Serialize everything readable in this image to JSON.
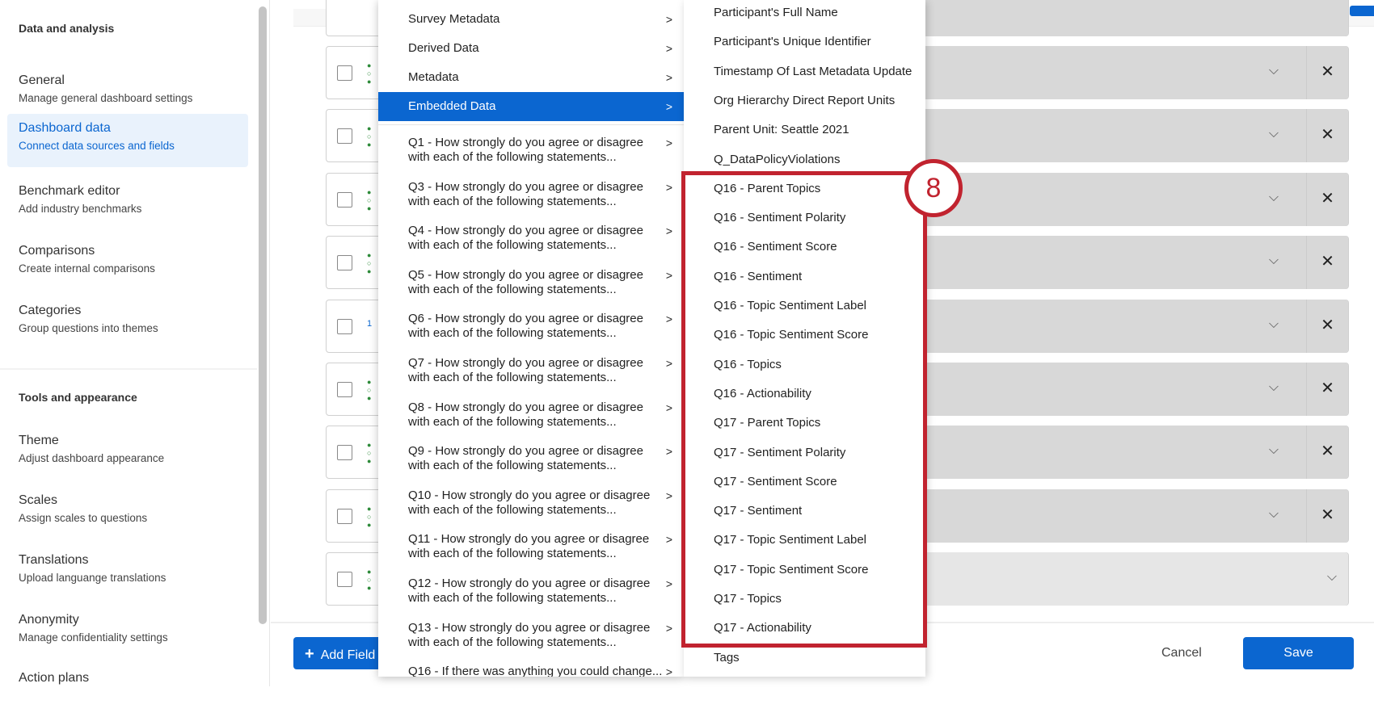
{
  "sidebar": {
    "section1": "Data and analysis",
    "section2": "Tools and appearance",
    "items": [
      {
        "title": "General",
        "subtitle": "Manage general dashboard settings"
      },
      {
        "title": "Dashboard data",
        "subtitle": "Connect data sources and fields"
      },
      {
        "title": "Benchmark editor",
        "subtitle": "Add industry benchmarks"
      },
      {
        "title": "Comparisons",
        "subtitle": "Create internal comparisons"
      },
      {
        "title": "Categories",
        "subtitle": "Group questions into themes"
      },
      {
        "title": "Theme",
        "subtitle": "Adjust dashboard appearance"
      },
      {
        "title": "Scales",
        "subtitle": "Assign scales to questions"
      },
      {
        "title": "Translations",
        "subtitle": "Upload languange translations"
      },
      {
        "title": "Anonymity",
        "subtitle": "Manage confidentiality settings"
      },
      {
        "title": "Action plans",
        "subtitle": ""
      }
    ]
  },
  "main": {
    "row_number_label": "1",
    "add_field": "Add Field",
    "cancel": "Cancel",
    "save": "Save",
    "remove_icon": "✕",
    "chevron": "⌵"
  },
  "menu1": {
    "items": [
      "Survey Metadata",
      "Derived Data",
      "Metadata",
      "Embedded Data"
    ],
    "questions": [
      "Q1 - How strongly do you agree or disagree with each of the following statements...",
      "Q3 - How strongly do you agree or disagree with each of the following statements...",
      "Q4 - How strongly do you agree or disagree with each of the following statements...",
      "Q5 - How strongly do you agree or disagree with each of the following statements...",
      "Q6 - How strongly do you agree or disagree with each of the following statements...",
      "Q7 - How strongly do you agree or disagree with each of the following statements...",
      "Q8 - How strongly do you agree or disagree with each of the following statements...",
      "Q9 - How strongly do you agree or disagree with each of the following statements...",
      "Q10 - How strongly do you agree or disagree with each of the following statements...",
      "Q11 - How strongly do you agree or disagree with each of the following statements...",
      "Q12 - How strongly do you agree or disagree with each of the following statements...",
      "Q13 - How strongly do you agree or disagree with each of the following statements...",
      "Q16 - If there was anything you could change..."
    ]
  },
  "menu2": {
    "items": [
      "Participant's Full Name",
      "Participant's Unique Identifier",
      "Timestamp Of Last Metadata Update",
      "Org Hierarchy Direct Report Units",
      "Parent Unit: Seattle 2021",
      "Q_DataPolicyViolations",
      "Q16 - Parent Topics",
      "Q16 - Sentiment Polarity",
      "Q16 - Sentiment Score",
      "Q16 - Sentiment",
      "Q16 - Topic Sentiment Label",
      "Q16 - Topic Sentiment Score",
      "Q16 - Topics",
      "Q16 - Actionability",
      "Q17 - Parent Topics",
      "Q17 - Sentiment Polarity",
      "Q17 - Sentiment Score",
      "Q17 - Sentiment",
      "Q17 - Topic Sentiment Label",
      "Q17 - Topic Sentiment Score",
      "Q17 - Topics",
      "Q17 - Actionability",
      "Tags"
    ]
  },
  "annotation": {
    "step": "8",
    "color": "#c1232f"
  },
  "colors": {
    "accent": "#0b66d0"
  }
}
